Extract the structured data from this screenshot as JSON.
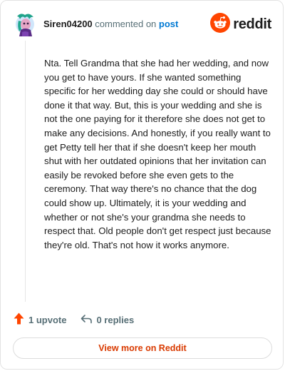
{
  "comment": {
    "username": "Siren04200",
    "action_text": "commented on",
    "post_link_text": "post",
    "body": "Nta. Tell Grandma that she had her wedding, and now you get to have yours. If she wanted something specific for her wedding day she could or should have done it that way. But, this is your wedding and she is not the one paying for it therefore she does not get to make any decisions. And honestly, if you really want to get Petty tell her that if she doesn't keep her mouth shut with her outdated opinions that her invitation can easily be revoked before she even gets to the ceremony. That way there's no chance that the dog could show up. Ultimately, it is your wedding and whether or not she's your grandma she needs to respect that. Old people don't get respect just because they're old. That's not how it works anymore.",
    "upvote_label": "1 upvote",
    "replies_label": "0 replies"
  },
  "brand": {
    "name": "reddit",
    "icon": "reddit-logo-icon",
    "color": "#ff4500"
  },
  "footer": {
    "view_more_label": "View more on Reddit"
  },
  "colors": {
    "accent": "#ff4500",
    "link": "#0079d3",
    "muted": "#576f76",
    "button_text": "#d93a00"
  },
  "icons": {
    "upvote": "upvote-arrow-icon",
    "reply": "reply-arrow-icon",
    "avatar": "user-avatar"
  }
}
